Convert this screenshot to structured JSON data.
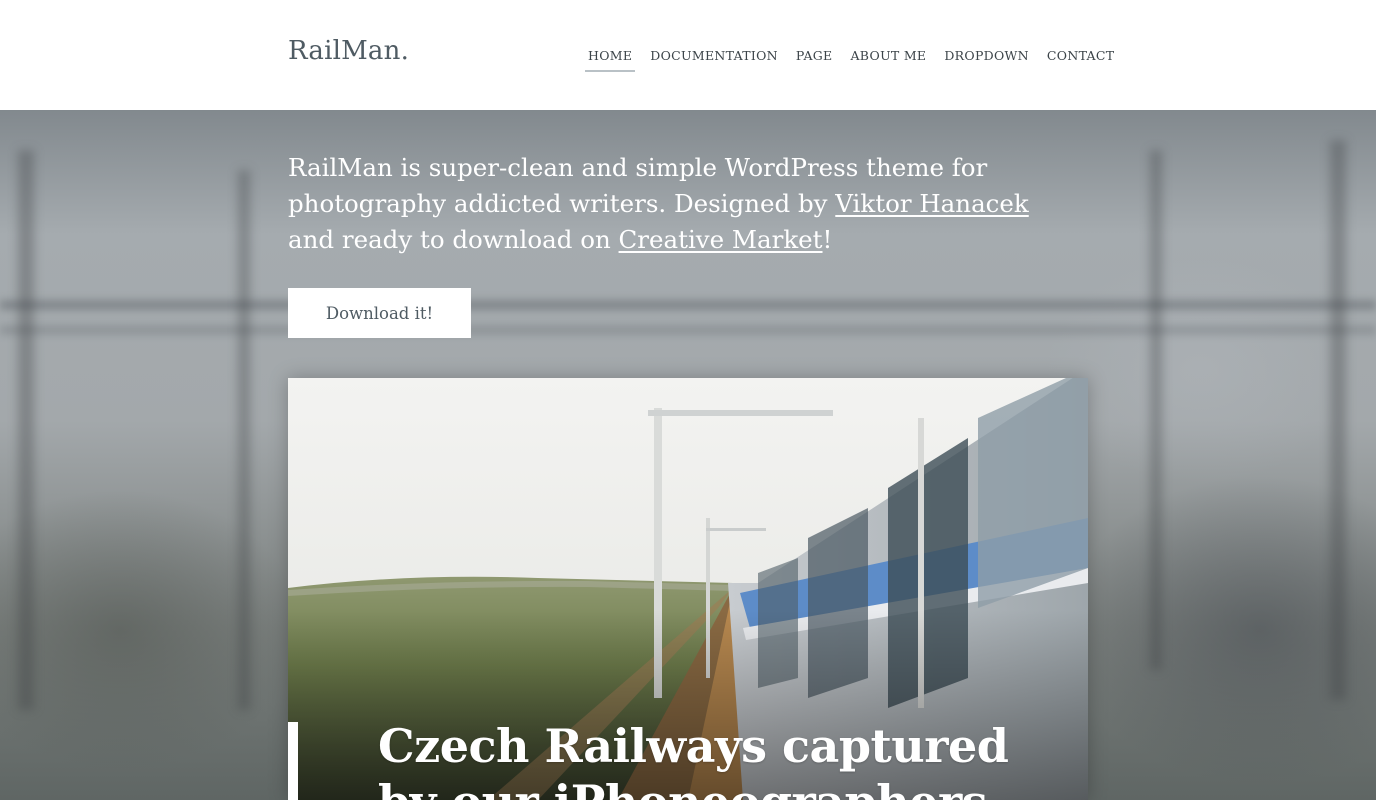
{
  "header": {
    "logo": "RailMan.",
    "nav": [
      {
        "label": "HOME",
        "active": true
      },
      {
        "label": "DOCUMENTATION",
        "active": false
      },
      {
        "label": "PAGE",
        "active": false
      },
      {
        "label": "ABOUT ME",
        "active": false
      },
      {
        "label": "DROPDOWN",
        "active": false
      },
      {
        "label": "CONTACT",
        "active": false
      }
    ]
  },
  "hero": {
    "tagline_part1": "RailMan is super-clean and simple WordPress theme for photography addicted writers. Designed by ",
    "designer_link": "Viktor Hanacek",
    "tagline_part2": " and ready to download on ",
    "market_link": "Creative Market",
    "tagline_part3": "!",
    "download_label": "Download it!"
  },
  "featured_post": {
    "title": "Czech Railways captured by our iPhoneographers"
  },
  "colors": {
    "header_bg": "#ffffff",
    "logo": "#4f5b63",
    "nav_text": "#3c4449",
    "nav_active_underline": "#b9c1c6",
    "hero_text": "#ffffff",
    "button_bg": "#ffffff",
    "button_text": "#4f5b63"
  }
}
